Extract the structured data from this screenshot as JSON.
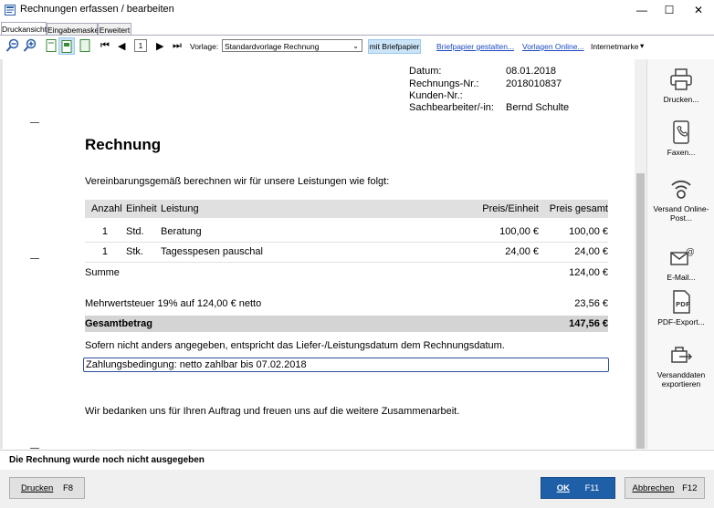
{
  "window": {
    "title": "Rechnungen erfassen / bearbeiten",
    "minimize": "—",
    "maximize": "☐",
    "close": "✕"
  },
  "tabs": [
    {
      "label": "Druckansicht",
      "active": true
    },
    {
      "label": "Eingabemaske",
      "active": false
    },
    {
      "label": "Erweitert",
      "active": false
    }
  ],
  "toolbar": {
    "page_number": "1",
    "vorlage_label": "Vorlage:",
    "vorlage_value": "Standardvorlage Rechnung",
    "letterhead_button": "mit Briefpapier",
    "link_briefpapier": "Briefpapier gestalten...",
    "link_vorlagen": "Vorlagen Online...",
    "internetmarke": "Internetmarke",
    "internetmarke_arrow": "▾"
  },
  "document": {
    "meta": [
      {
        "label": "Datum:",
        "value": "08.01.2018"
      },
      {
        "label": "Rechnungs-Nr.:",
        "value": "2018010837"
      },
      {
        "label": "Kunden-Nr.:",
        "value": ""
      },
      {
        "label": "Sachbearbeiter/-in:",
        "value": "Bernd Schulte"
      }
    ],
    "heading": "Rechnung",
    "intro": "Vereinbarungsgemäß berechnen wir für unsere Leistungen wie folgt:",
    "table": {
      "headers": [
        "Anzahl",
        "Einheit",
        "Leistung",
        "Preis/Einheit",
        "Preis gesamt"
      ],
      "rows": [
        [
          "1",
          "Std.",
          "Beratung",
          "100,00 €",
          "100,00 €"
        ],
        [
          "1",
          "Stk.",
          "Tagesspesen pauschal",
          "24,00 €",
          "24,00 €"
        ]
      ]
    },
    "summe_label": "Summe",
    "summe_value": "124,00 €",
    "mwst_label": "Mehrwertsteuer 19% auf 124,00 € netto",
    "mwst_value": "23,56 €",
    "gesamt_label": "Gesamtbetrag",
    "gesamt_value": "147,56 €",
    "note": "Sofern nicht anders angegeben, entspricht das Liefer-/Leistungsdatum dem Rechnungsdatum.",
    "payment_terms": "Zahlungsbedingung: netto zahlbar bis 07.02.2018",
    "closing": "Wir bedanken uns für Ihren Auftrag und freuen uns auf die weitere Zusammenarbeit."
  },
  "sidebar": [
    {
      "icon": "printer-icon",
      "label": "Drucken..."
    },
    {
      "icon": "fax-icon",
      "label": "Faxen..."
    },
    {
      "icon": "online-post-icon",
      "label": "Versand Online-Post..."
    },
    {
      "icon": "email-icon",
      "label": "E-Mail..."
    },
    {
      "icon": "pdf-icon",
      "label": "PDF-Export..."
    },
    {
      "icon": "export-icon",
      "label": "Versanddaten exportieren"
    }
  ],
  "status": "Die Rechnung wurde noch nicht ausgegeben",
  "buttons": {
    "print": {
      "label": "Drucken",
      "shortcut": "F8"
    },
    "ok": {
      "label": "OK",
      "shortcut": "F11"
    },
    "cancel": {
      "label": "Abbrechen",
      "shortcut": "F12"
    }
  },
  "colors": {
    "accent": "#1f5fa8",
    "link": "#1a49c2"
  }
}
